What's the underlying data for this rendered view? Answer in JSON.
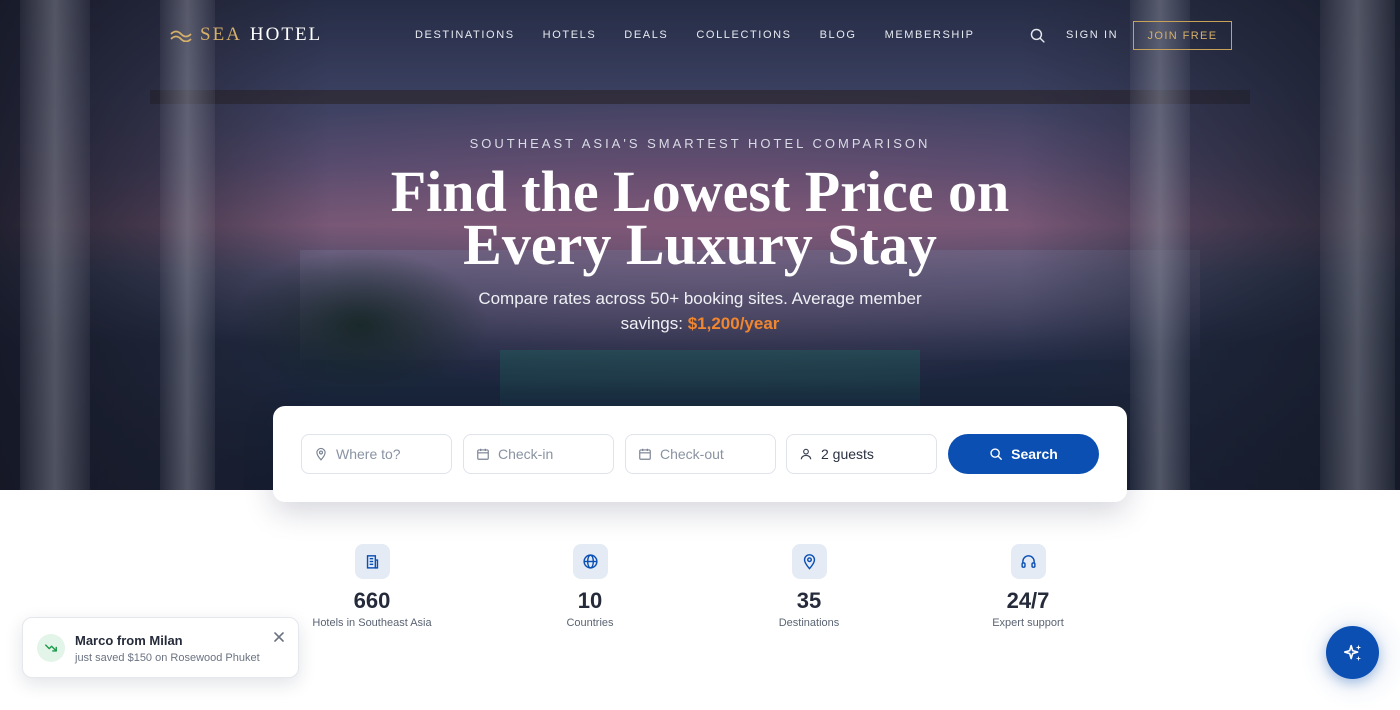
{
  "brand": {
    "name_accent": "SEA",
    "name_rest": "HOTEL"
  },
  "nav": {
    "items": [
      {
        "label": "DESTINATIONS"
      },
      {
        "label": "HOTELS"
      },
      {
        "label": "DEALS"
      },
      {
        "label": "COLLECTIONS"
      },
      {
        "label": "BLOG"
      },
      {
        "label": "MEMBERSHIP"
      }
    ],
    "search_icon": "search-icon",
    "sign_in": "SIGN IN",
    "join": "JOIN FREE"
  },
  "hero": {
    "eyebrow": "SOUTHEAST ASIA'S SMARTEST HOTEL COMPARISON",
    "headline": "Find the Lowest Price on Every Luxury Stay",
    "subtitle": "Compare rates across 50+ booking sites. Average member savings:",
    "savings": "$1,200/year"
  },
  "search": {
    "where": {
      "placeholder": "Where to?",
      "icon": "map-pin-icon"
    },
    "checkin": {
      "placeholder": "Check-in",
      "icon": "calendar-icon"
    },
    "checkout": {
      "placeholder": "Check-out",
      "icon": "calendar-icon"
    },
    "guests": {
      "value": "2 guests",
      "icon": "user-icon"
    },
    "button": "Search"
  },
  "stats": [
    {
      "value": "660",
      "label": "Hotels in Southeast Asia",
      "icon": "building-icon"
    },
    {
      "value": "10",
      "label": "Countries",
      "icon": "globe-icon"
    },
    {
      "value": "35",
      "label": "Destinations",
      "icon": "map-pin-icon"
    },
    {
      "value": "24/7",
      "label": "Expert support",
      "icon": "headset-icon"
    }
  ],
  "toast": {
    "title": "Marco from Milan",
    "text": "just saved $150 on Rosewood Phuket",
    "icon": "trending-down-icon"
  },
  "fab": {
    "icon": "sparkles-icon"
  },
  "colors": {
    "primary": "#0b4fb3",
    "gold": "#d6b06a",
    "accent_orange": "#f0862f"
  }
}
